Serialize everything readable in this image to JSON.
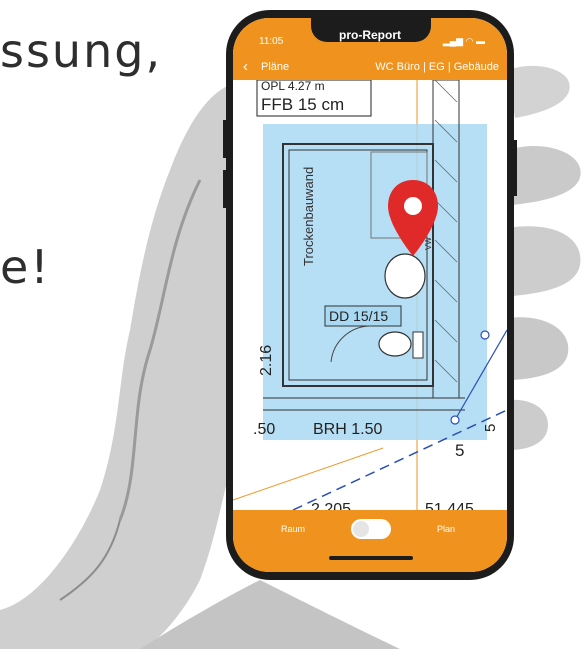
{
  "background": {
    "text_line1": "ssung,",
    "text_line2": "e!"
  },
  "status_bar": {
    "time": "11:05",
    "app_title": "pro-Report",
    "icons": [
      "signal-icon",
      "wifi-icon",
      "battery-icon"
    ]
  },
  "nav": {
    "back_label": "Pläne",
    "breadcrumb": "WC Büro | EG | Gebäude"
  },
  "plan": {
    "labels": {
      "top_partial": "OPL 4.27 m",
      "ffb": "FFB 15 cm",
      "wall": "Trockenbauwand",
      "ceiling_opening": "DD 15/15",
      "dim_left": "2.16",
      "brh_left": ".50",
      "brh": "BRH 1.50",
      "vw": "VW",
      "dim_right_5": "5",
      "dim_5_fraction": "5",
      "bottom_left_dim": "2.205",
      "bottom_right_dim": "51.445"
    },
    "pin_color": "#e02a2a",
    "highlight_color": "#a9d8f2"
  },
  "bottom_bar": {
    "left_label": "Raum",
    "right_label": "Plan",
    "toggle_state": "off"
  },
  "colors": {
    "accent": "#f0931e",
    "phone_frame": "#1c1c1c"
  }
}
